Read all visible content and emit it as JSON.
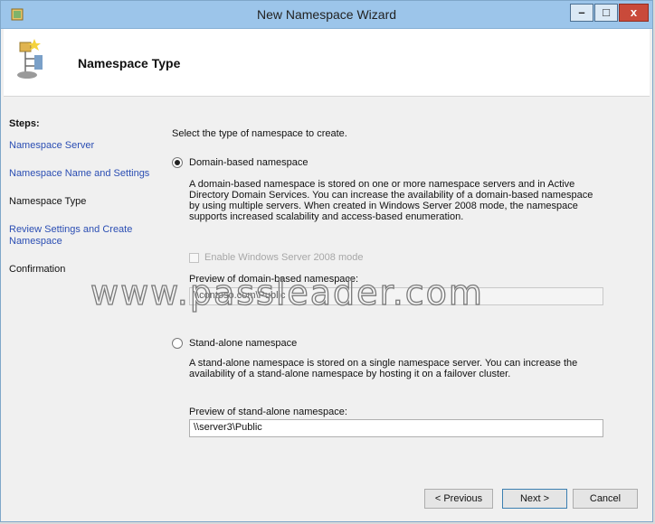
{
  "window": {
    "title": "New Namespace Wizard",
    "controls": {
      "minimize": "–",
      "maximize": "□",
      "close": "x"
    }
  },
  "header": {
    "title": "Namespace Type"
  },
  "steps": {
    "title": "Steps:",
    "items": [
      {
        "label": "Namespace Server"
      },
      {
        "label": "Namespace Name and Settings"
      },
      {
        "label": "Namespace Type"
      },
      {
        "label": "Review Settings and Create Namespace"
      },
      {
        "label": "Confirmation"
      }
    ]
  },
  "content": {
    "prompt": "Select the type of namespace to create.",
    "domain": {
      "label": "Domain-based namespace",
      "selected": true,
      "description": "A domain-based namespace is stored on one or more namespace servers and in Active Directory Domain Services. You can increase the availability of a domain-based namespace by using multiple servers. When created in Windows Server 2008 mode, the namespace supports increased scalability and access-based enumeration.",
      "checkbox_label": "Enable Windows Server 2008 mode",
      "preview_label": "Preview of domain-based namespace:",
      "preview_value": "\\\\contoso.com\\Public"
    },
    "standalone": {
      "label": "Stand-alone namespace",
      "selected": false,
      "description": "A stand-alone namespace is stored on a single namespace server. You can increase the availability of a stand-alone namespace by hosting it on a failover cluster.",
      "preview_label": "Preview of stand-alone namespace:",
      "preview_value": "\\\\server3\\Public"
    }
  },
  "watermark": "www.passleader.com",
  "footer": {
    "previous": "< Previous",
    "next": "Next >",
    "cancel": "Cancel"
  },
  "colors": {
    "titlebar": "#9cc5ea",
    "link": "#2b4eb3",
    "close_button": "#c94a3a"
  }
}
